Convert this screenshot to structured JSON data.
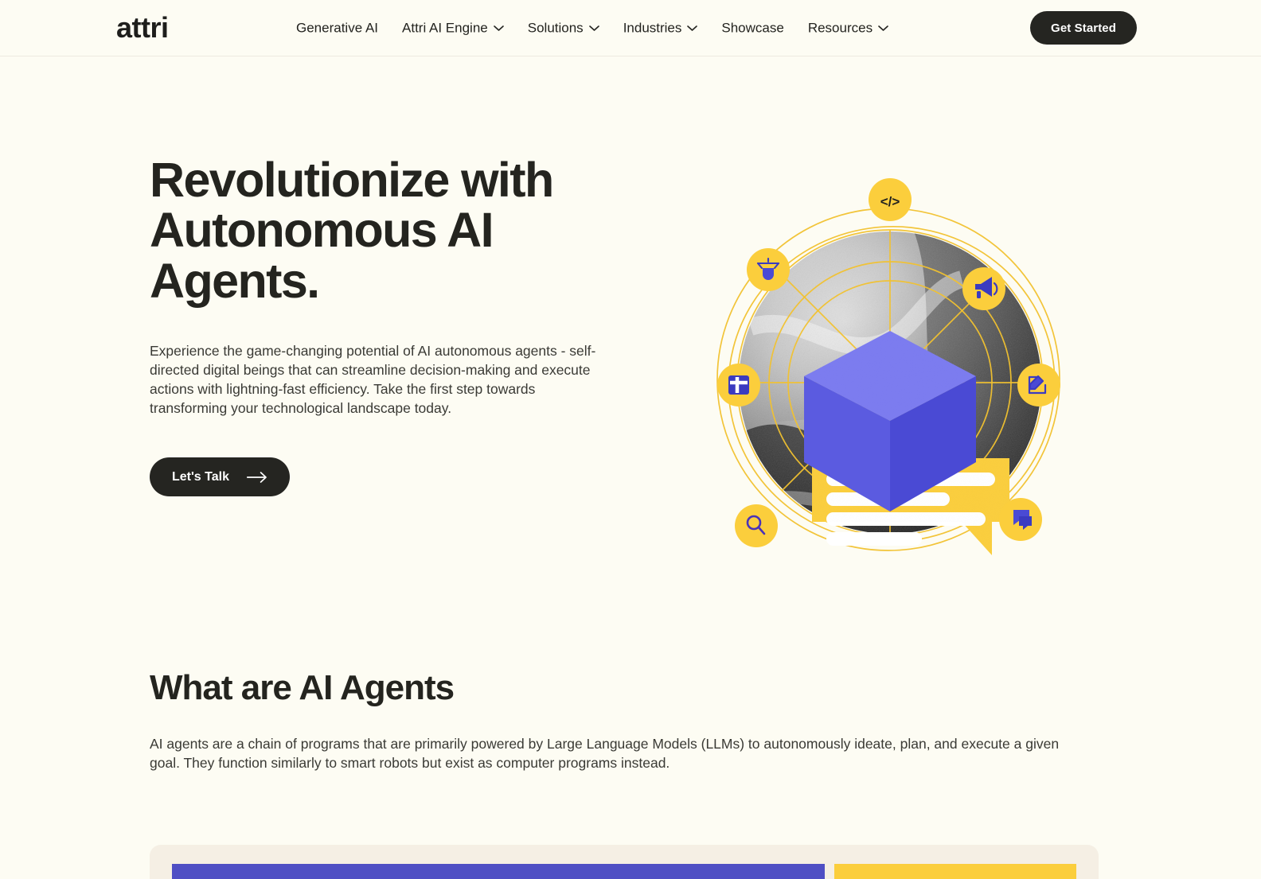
{
  "brand": {
    "name": "attri"
  },
  "nav": {
    "items": [
      {
        "label": "Generative AI",
        "has_chevron": false,
        "icon": null
      },
      {
        "label": "Attri AI Engine",
        "has_chevron": true,
        "icon": "chevron-down-icon"
      },
      {
        "label": "Solutions",
        "has_chevron": true,
        "icon": "chevron-down-icon"
      },
      {
        "label": "Industries",
        "has_chevron": true,
        "icon": "chevron-down-icon"
      },
      {
        "label": "Showcase",
        "has_chevron": false,
        "icon": null
      },
      {
        "label": "Resources",
        "has_chevron": true,
        "icon": "chevron-down-icon"
      }
    ],
    "cta_label": "Get Started"
  },
  "hero": {
    "title_line1": "Revolutionize with",
    "title_line2": "Autonomous AI",
    "title_line3": "Agents.",
    "subtitle": "Experience the game-changing potential of AI autonomous agents - self-directed digital beings that can streamline decision-making and execute actions with lightning-fast efficiency. Take the first step towards transforming your technological landscape today.",
    "cta_label": "Let's Talk",
    "cta_icon": "arrow-right-icon",
    "illustration": {
      "name": "ai-agents-orbit-illustration",
      "center_object": "blue-isometric-cube",
      "speech_bubble": "yellow-chat-bubble",
      "orbit_icons": [
        {
          "name": "code-icon",
          "glyph": "</>"
        },
        {
          "name": "megaphone-icon",
          "glyph": "megaphone"
        },
        {
          "name": "edit-pencil-icon",
          "glyph": "pencil-square"
        },
        {
          "name": "chat-icon",
          "glyph": "chat-bubbles"
        },
        {
          "name": "search-icon",
          "glyph": "magnifier"
        },
        {
          "name": "image-icon",
          "glyph": "picture-frame"
        },
        {
          "name": "drone-icon",
          "glyph": "drone-lamp"
        }
      ]
    }
  },
  "section_about": {
    "title": "What are AI Agents",
    "body": "AI agents are a chain of programs that are primarily powered by Large Language Models (LLMs) to autonomously ideate, plan, and execute a given goal. They function similarly to smart robots but exist as computer programs instead."
  },
  "bottom_card": {
    "name": "feature-card",
    "bar_primary": "",
    "bar_secondary": ""
  },
  "colors": {
    "page_background": "#FDFCF3",
    "card_background": "#F5EFE4",
    "text_dark": "#24241F",
    "text_body": "#3A3A35",
    "accent_yellow": "#FBCE3C",
    "accent_blue": "#5B5BE0",
    "bar_blue": "#4F4FC4",
    "button_dark": "#252521",
    "nav_border": "#EDEAE0"
  }
}
